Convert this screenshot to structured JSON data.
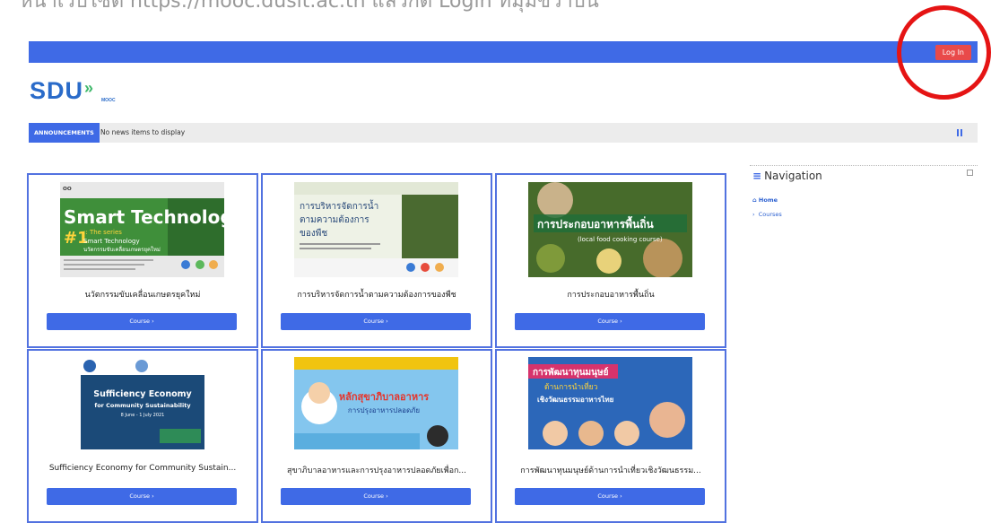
{
  "top_caption": "หน้าเว็บไซต์ https://mooc.dusit.ac.th แล้วกด Login ที่มุมขวาบน",
  "header": {
    "login_label": "Log In"
  },
  "logo": {
    "text": "SDU",
    "chevron": "»",
    "sub": "MOOC"
  },
  "announcements": {
    "tag": "ANNOUNCEMENTS",
    "text": "No news items to display"
  },
  "courses": [
    {
      "title": "นวัตกรรมขับเคลื่อนเกษตรยุคใหม่",
      "button": "Course ›",
      "thumb": {
        "big": "Smart Technology",
        "num": "#1",
        "sub": ":: The series",
        "line": "Smart Technology",
        "thai": "นวัตกรรมขับเคลื่อนเกษตรยุคใหม่"
      }
    },
    {
      "title": "การบริหารจัดการน้ำตามความต้องการของพืช",
      "button": "Course ›",
      "thumb": {
        "line1": "การบริหารจัดการน้ำ",
        "line2": "ตามความต้องการ",
        "line3": "ของพืช"
      }
    },
    {
      "title": "การประกอบอาหารพื้นถิ่น",
      "button": "Course ›",
      "thumb": {
        "line1": "การประกอบอาหารพื้นถิ่น",
        "line2": "(local food cooking course)"
      }
    },
    {
      "title": "Sufficiency Economy for Community Sustain...",
      "button": "Course ›",
      "thumb": {
        "line1": "Sufficiency Economy",
        "line2": "for Community Sustainability",
        "line3": "8 June - 1 July 2021"
      }
    },
    {
      "title": "สุขาภิบาลอาหารและการปรุงอาหารปลอดภัยเพื่อก...",
      "button": "Course ›",
      "thumb": {
        "line1": "หลักสุขาภิบาลอาหาร",
        "line2": "การปรุงอาหารปลอดภัย"
      }
    },
    {
      "title": "การพัฒนาทุนมนุษย์ด้านการนำเที่ยวเชิงวัฒนธรรม...",
      "button": "Course ›",
      "thumb": {
        "line1": "การพัฒนาทุนมนุษย์",
        "line2": "ด้านการนำเที่ยว",
        "line3": "เชิงวัฒนธรรมอาหารไทย"
      }
    }
  ],
  "navigation": {
    "title": "Navigation",
    "home": "Home",
    "courses": "Courses"
  },
  "colors": {
    "navbar": "#3f6ae6",
    "login": "#e94a4a",
    "annotation_circle": "#e51414"
  }
}
